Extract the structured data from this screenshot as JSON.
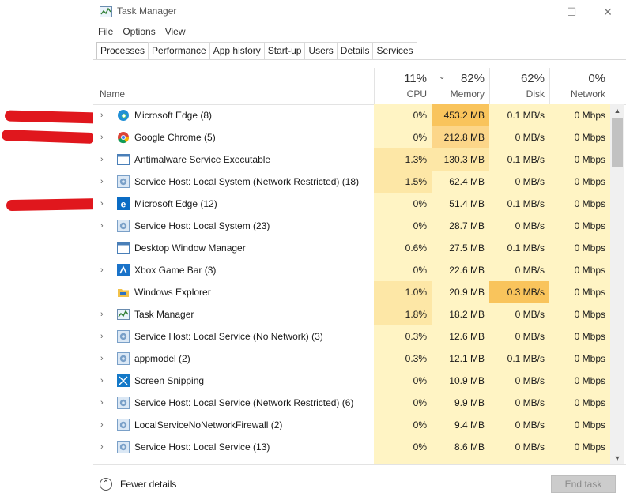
{
  "window": {
    "title": "Task Manager",
    "controls": {
      "minimize": "—",
      "maximize": "☐",
      "close": "✕"
    }
  },
  "menu": [
    "File",
    "Options",
    "View"
  ],
  "tabs": [
    "Processes",
    "Performance",
    "App history",
    "Start-up",
    "Users",
    "Details",
    "Services"
  ],
  "active_tab": "Processes",
  "columns": {
    "name_label": "Name",
    "cpu": {
      "pct": "11%",
      "label": "CPU"
    },
    "memory": {
      "pct": "82%",
      "label": "Memory",
      "sort_indicator": "⌄"
    },
    "disk": {
      "pct": "62%",
      "label": "Disk"
    },
    "network": {
      "pct": "0%",
      "label": "Network"
    }
  },
  "processes": [
    {
      "name": "Microsoft Edge (8)",
      "icon": "edge-icon",
      "expandable": true,
      "cpu": "0%",
      "memory": "453.2 MB",
      "disk": "0.1 MB/s",
      "network": "0 Mbps"
    },
    {
      "name": "Google Chrome (5)",
      "icon": "chrome-icon",
      "expandable": true,
      "cpu": "0%",
      "memory": "212.8 MB",
      "disk": "0 MB/s",
      "network": "0 Mbps"
    },
    {
      "name": "Antimalware Service Executable",
      "icon": "window-app-icon",
      "expandable": true,
      "cpu": "1.3%",
      "memory": "130.3 MB",
      "disk": "0.1 MB/s",
      "network": "0 Mbps"
    },
    {
      "name": "Service Host: Local System (Network Restricted) (18)",
      "icon": "gear-service-icon",
      "expandable": true,
      "cpu": "1.5%",
      "memory": "62.4 MB",
      "disk": "0 MB/s",
      "network": "0 Mbps"
    },
    {
      "name": "Microsoft Edge (12)",
      "icon": "edge-legacy-icon",
      "expandable": true,
      "cpu": "0%",
      "memory": "51.4 MB",
      "disk": "0.1 MB/s",
      "network": "0 Mbps"
    },
    {
      "name": "Service Host: Local System (23)",
      "icon": "gear-service-icon",
      "expandable": true,
      "cpu": "0%",
      "memory": "28.7 MB",
      "disk": "0 MB/s",
      "network": "0 Mbps"
    },
    {
      "name": "Desktop Window Manager",
      "icon": "window-app-icon",
      "expandable": false,
      "cpu": "0.6%",
      "memory": "27.5 MB",
      "disk": "0.1 MB/s",
      "network": "0 Mbps"
    },
    {
      "name": "Xbox Game Bar (3)",
      "icon": "xbox-icon",
      "expandable": true,
      "cpu": "0%",
      "memory": "22.6 MB",
      "disk": "0 MB/s",
      "network": "0 Mbps"
    },
    {
      "name": "Windows Explorer",
      "icon": "folder-icon",
      "expandable": false,
      "cpu": "1.0%",
      "memory": "20.9 MB",
      "disk": "0.3 MB/s",
      "network": "0 Mbps"
    },
    {
      "name": "Task Manager",
      "icon": "task-manager-icon",
      "expandable": true,
      "cpu": "1.8%",
      "memory": "18.2 MB",
      "disk": "0 MB/s",
      "network": "0 Mbps"
    },
    {
      "name": "Service Host: Local Service (No Network) (3)",
      "icon": "gear-service-icon",
      "expandable": true,
      "cpu": "0.3%",
      "memory": "12.6 MB",
      "disk": "0 MB/s",
      "network": "0 Mbps"
    },
    {
      "name": "appmodel (2)",
      "icon": "gear-service-icon",
      "expandable": true,
      "cpu": "0.3%",
      "memory": "12.1 MB",
      "disk": "0.1 MB/s",
      "network": "0 Mbps"
    },
    {
      "name": "Screen Snipping",
      "icon": "snipping-icon",
      "expandable": true,
      "cpu": "0%",
      "memory": "10.9 MB",
      "disk": "0 MB/s",
      "network": "0 Mbps"
    },
    {
      "name": "Service Host: Local Service (Network Restricted) (6)",
      "icon": "gear-service-icon",
      "expandable": true,
      "cpu": "0%",
      "memory": "9.9 MB",
      "disk": "0 MB/s",
      "network": "0 Mbps"
    },
    {
      "name": "LocalServiceNoNetworkFirewall (2)",
      "icon": "gear-service-icon",
      "expandable": true,
      "cpu": "0%",
      "memory": "9.4 MB",
      "disk": "0 MB/s",
      "network": "0 Mbps"
    },
    {
      "name": "Service Host: Local Service (13)",
      "icon": "gear-service-icon",
      "expandable": true,
      "cpu": "0%",
      "memory": "8.6 MB",
      "disk": "0 MB/s",
      "network": "0 Mbps"
    },
    {
      "name": "",
      "icon": "window-app-icon",
      "expandable": false,
      "cpu": "",
      "memory": "",
      "disk": "",
      "network": ""
    }
  ],
  "footer": {
    "fewer_details": "Fewer details",
    "end_task": "End task"
  },
  "colors": {
    "light": "#fff4c4",
    "medium": "#fde7a6",
    "strong": "#fcd689",
    "hot": "#f9c45c",
    "redaction": "#e0171d"
  }
}
